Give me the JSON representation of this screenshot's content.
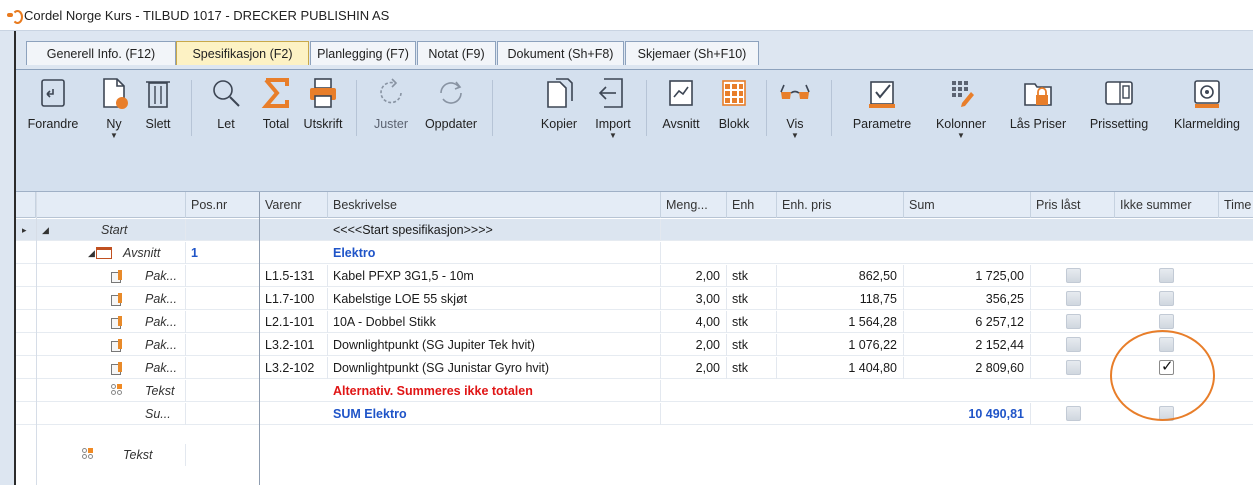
{
  "window": {
    "title": "Cordel Norge Kurs - TILBUD 1017 - DRECKER PUBLISHIN AS"
  },
  "tabs": [
    {
      "label": "Generell Info. (F12)",
      "active": false
    },
    {
      "label": "Spesifikasjon (F2)",
      "active": true
    },
    {
      "label": "Planlegging (F7)",
      "active": false
    },
    {
      "label": "Notat (F9)",
      "active": false
    },
    {
      "label": "Dokument (Sh+F8)",
      "active": false
    },
    {
      "label": "Skjemaer (Sh+F10)",
      "active": false
    }
  ],
  "toolbar": {
    "forandre": "Forandre",
    "ny": "Ny",
    "slett": "Slett",
    "let": "Let",
    "total": "Total",
    "utskrift": "Utskrift",
    "juster": "Juster",
    "oppdater": "Oppdater",
    "kopier": "Kopier",
    "import": "Import",
    "avsnitt": "Avsnitt",
    "blokk": "Blokk",
    "vis": "Vis",
    "parametre": "Parametre",
    "kolonner": "Kolonner",
    "las_priser": "Lås Priser",
    "prissetting": "Prissetting",
    "klarmelding": "Klarmelding"
  },
  "grid": {
    "columns": [
      "Pos.nr",
      "Varenr",
      "Beskrivelse",
      "Meng...",
      "Enh",
      "Enh. pris",
      "Sum",
      "Pris låst",
      "Ikke summer",
      "Time"
    ],
    "rows": [
      {
        "type": "Start",
        "posnr": "",
        "varenr": "",
        "beskrivelse": "<<<<Start spesifikasjon>>>>",
        "mengde": "",
        "enh": "",
        "enhpris": "",
        "sum": ""
      },
      {
        "type": "Avsnitt",
        "posnr": "1",
        "varenr": "",
        "beskrivelse": "Elektro",
        "mengde": "",
        "enh": "",
        "enhpris": "",
        "sum": ""
      },
      {
        "type": "Pak...",
        "posnr": "",
        "varenr": "L1.5-131",
        "beskrivelse": "Kabel PFXP 3G1,5 - 10m",
        "mengde": "2,00",
        "enh": "stk",
        "enhpris": "862,50",
        "sum": "1 725,00",
        "pris_last": false,
        "ikke_summer": false
      },
      {
        "type": "Pak...",
        "posnr": "",
        "varenr": "L1.7-100",
        "beskrivelse": "Kabelstige LOE 55 skjøt",
        "mengde": "3,00",
        "enh": "stk",
        "enhpris": "118,75",
        "sum": "356,25",
        "pris_last": false,
        "ikke_summer": false
      },
      {
        "type": "Pak...",
        "posnr": "",
        "varenr": "L2.1-101",
        "beskrivelse": "10A - Dobbel Stikk",
        "mengde": "4,00",
        "enh": "stk",
        "enhpris": "1 564,28",
        "sum": "6 257,12",
        "pris_last": false,
        "ikke_summer": false
      },
      {
        "type": "Pak...",
        "posnr": "",
        "varenr": "L3.2-101",
        "beskrivelse": "Downlightpunkt (SG Jupiter Tek hvit)",
        "mengde": "2,00",
        "enh": "stk",
        "enhpris": "1 076,22",
        "sum": "2 152,44",
        "pris_last": false,
        "ikke_summer": false
      },
      {
        "type": "Pak...",
        "posnr": "",
        "varenr": "L3.2-102",
        "beskrivelse": "Downlightpunkt (SG Junistar Gyro hvit)",
        "mengde": "2,00",
        "enh": "stk",
        "enhpris": "1 404,80",
        "sum": "2 809,60",
        "pris_last": false,
        "ikke_summer": true
      },
      {
        "type": "Tekst",
        "posnr": "",
        "varenr": "",
        "beskrivelse": "Alternativ. Summeres ikke totalen",
        "mengde": "",
        "enh": "",
        "enhpris": "",
        "sum": ""
      },
      {
        "type": "Su...",
        "posnr": "",
        "varenr": "",
        "beskrivelse": "SUM Elektro",
        "mengde": "",
        "enh": "",
        "enhpris": "",
        "sum": "10 490,81",
        "pris_last": false,
        "ikke_summer": false
      },
      {
        "type": "Tekst",
        "posnr": "",
        "varenr": "",
        "beskrivelse": "",
        "mengde": "",
        "enh": "",
        "enhpris": "",
        "sum": ""
      }
    ]
  },
  "colors": {
    "accent_orange": "#e87e2a",
    "avsnitt_blue": "#1f54c8",
    "text_red": "#e01515",
    "active_tab": "#fdf2c4"
  }
}
